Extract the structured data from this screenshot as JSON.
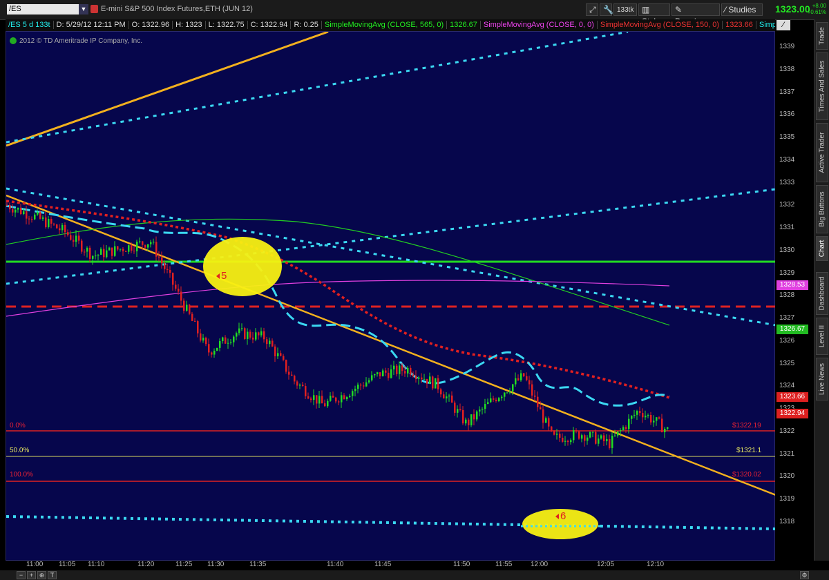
{
  "toolbar": {
    "symbol": "/ES",
    "description": "E-mini S&P 500 Index Futures,ETH (JUN 12)",
    "aggregation": "133tk",
    "style_label": "Style",
    "drawings_label": "Drawings",
    "studies_label": "Studies",
    "last_price": "1323.00",
    "change": "+8.00",
    "change_pct": "+0.61%"
  },
  "header": {
    "symbol_info": "/ES 5 d 133t",
    "date": "D: 5/29/12 12:11 PM",
    "open": "O: 1322.96",
    "high": "H: 1323",
    "low": "L: 1322.75",
    "close": "C: 1322.94",
    "range": "R: 0.25",
    "study1": "SimpleMovingAvg (CLOSE, 565, 0)",
    "study1_val": "1326.67",
    "study2": "SimpleMovingAvg (CLOSE, 0, 0)",
    "study3": "SimpleMovingAvg (CLOSE, 150, 0)",
    "study3_val": "1323.66",
    "study4": "SimpleMovin..."
  },
  "copyright": "2012 © TD Ameritrade IP Company, Inc.",
  "price_axis": [
    "1339",
    "1338",
    "1337",
    "1336",
    "1335",
    "1334",
    "1333",
    "1332",
    "1331",
    "1330",
    "1329",
    "1328",
    "1327",
    "1326",
    "1325",
    "1324",
    "1323",
    "1322",
    "1321",
    "1320",
    "1319",
    "1318"
  ],
  "price_labels": {
    "magenta": "1328.53",
    "green": "1326.67",
    "red_sma": "1323.66",
    "last": "1322.94"
  },
  "time_axis": [
    "11:00",
    "11:05",
    "11:10",
    "11:20",
    "11:25",
    "11:30",
    "11:35",
    "11:40",
    "11:45",
    "11:50",
    "11:55",
    "12:00",
    "12:05",
    "12:10"
  ],
  "fib": {
    "l0": "0.0%",
    "v0": "$1322.19",
    "l50": "50.0%",
    "v50": "$1321.1",
    "l100": "100.0%",
    "v100": "$1320.02"
  },
  "annotations": {
    "marker5": "5",
    "marker6": "6"
  },
  "side_tabs": [
    "Trade",
    "Times And Sales",
    "Active Trader",
    "Big Buttons",
    "Chart",
    "Dashboard",
    "Level II",
    "Live News"
  ],
  "chart_data": {
    "type": "candlestick",
    "ylim": [
      1317.5,
      1339.5
    ],
    "close_series_approx": [
      [
        "11:00",
        1332.3
      ],
      [
        "11:05",
        1331.8
      ],
      [
        "11:10",
        1331.2
      ],
      [
        "11:20",
        1330.2
      ],
      [
        "11:25",
        1330.5
      ],
      [
        "11:30",
        1330.8
      ],
      [
        "11:35",
        1328.5
      ],
      [
        "11:38",
        1326.2
      ],
      [
        "11:40",
        1327.0
      ],
      [
        "11:43",
        1326.8
      ],
      [
        "11:45",
        1325.0
      ],
      [
        "11:48",
        1324.0
      ],
      [
        "11:50",
        1324.6
      ],
      [
        "11:53",
        1325.3
      ],
      [
        "11:55",
        1325.5
      ],
      [
        "11:57",
        1324.8
      ],
      [
        "11:59",
        1323.2
      ],
      [
        "12:00",
        1324.3
      ],
      [
        "12:02",
        1325.2
      ],
      [
        "12:04",
        1322.6
      ],
      [
        "12:06",
        1322.8
      ],
      [
        "12:07",
        1322.4
      ],
      [
        "12:09",
        1323.8
      ],
      [
        "12:10",
        1322.94
      ]
    ],
    "horizontal_lines": {
      "green": 1329.6,
      "red_dashed": 1327.6,
      "fib_0": 1322.19,
      "fib_50": 1321.1,
      "fib_100": 1320.02
    }
  }
}
